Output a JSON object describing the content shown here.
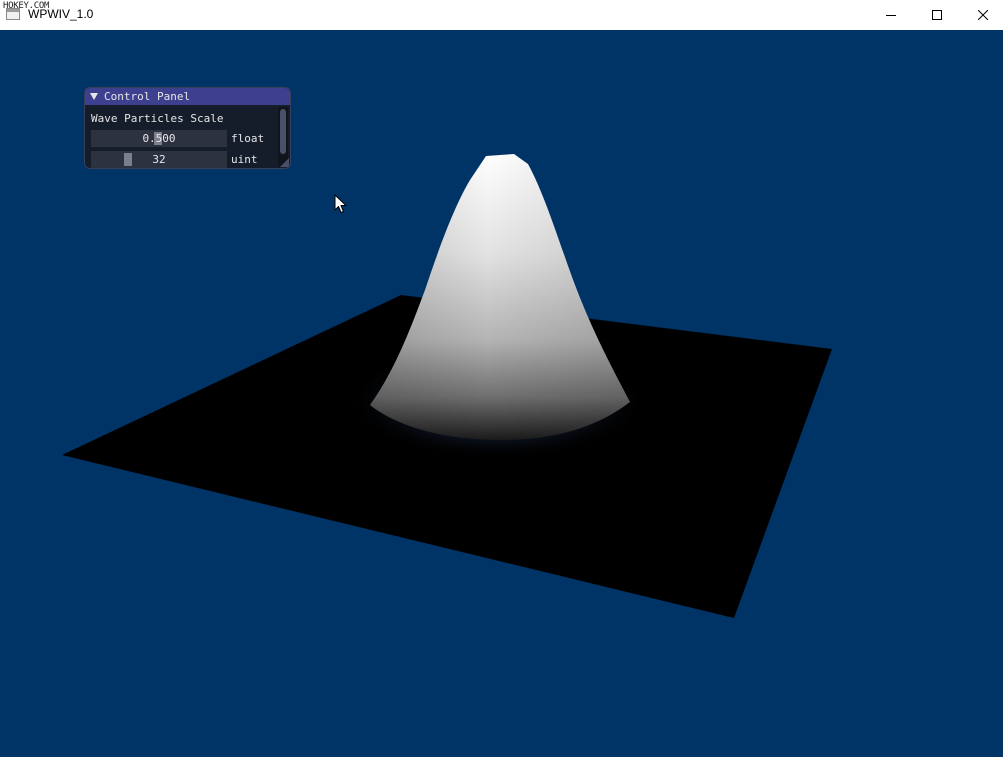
{
  "window": {
    "title": "WPWIV_1.0",
    "watermark": "HOKEY.COM",
    "controls": {
      "minimize": "minimize-icon",
      "maximize": "maximize-icon",
      "close": "close-icon"
    }
  },
  "viewport": {
    "background": "#003366",
    "plane_color": "#000000",
    "wave_color": "#ffffff"
  },
  "control_panel": {
    "title": "Control Panel",
    "collapse_icon": "triangle-down-icon",
    "section_label": "Wave Particles Scale",
    "sliders": [
      {
        "value": "0.500",
        "type_label": "float",
        "fraction": 0.5
      },
      {
        "value": "32",
        "type_label": "uint",
        "fraction": 0.25
      }
    ]
  },
  "cursor": {
    "icon": "arrow-cursor-icon"
  }
}
